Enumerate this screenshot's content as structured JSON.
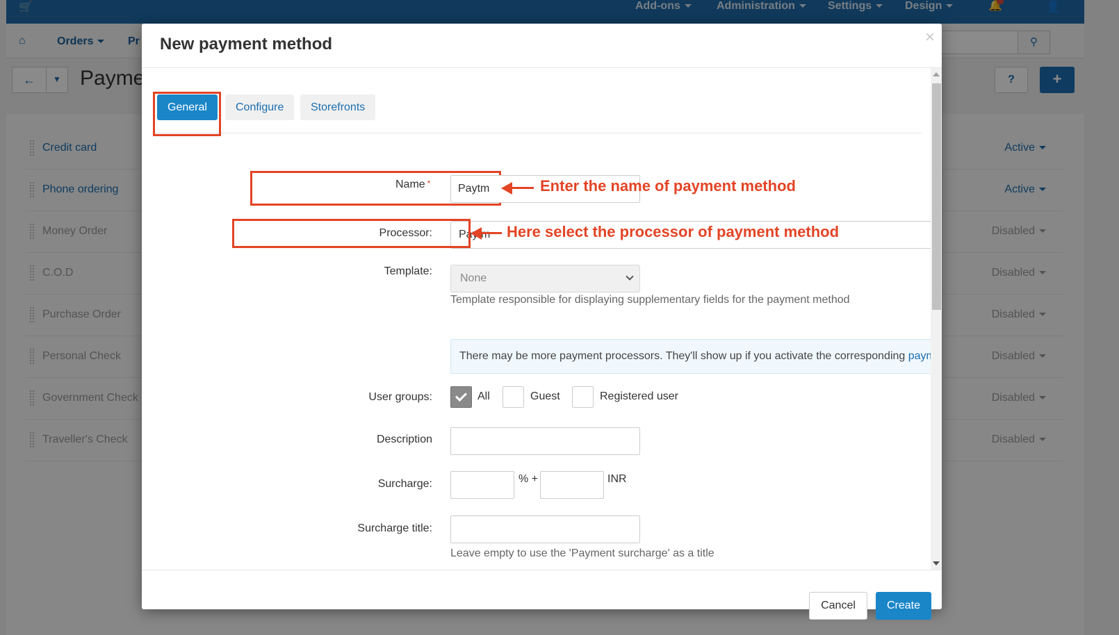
{
  "topbar": {
    "menus": [
      "Add-ons",
      "Administration",
      "Settings",
      "Design"
    ]
  },
  "nav": {
    "items": [
      "Orders",
      "Pr"
    ]
  },
  "toolbar": {
    "page_title": "Payme"
  },
  "payment_methods": [
    {
      "name": "Credit card",
      "status": "Active"
    },
    {
      "name": "Phone ordering",
      "status": "Active"
    },
    {
      "name": "Money Order",
      "status": "Disabled"
    },
    {
      "name": "C.O.D",
      "status": "Disabled"
    },
    {
      "name": "Purchase Order",
      "status": "Disabled"
    },
    {
      "name": "Personal Check",
      "status": "Disabled"
    },
    {
      "name": "Government Check",
      "status": "Disabled"
    },
    {
      "name": "Traveller's Check",
      "status": "Disabled"
    }
  ],
  "modal": {
    "title": "New payment method",
    "close": "×",
    "tabs": [
      "General",
      "Configure",
      "Storefronts"
    ],
    "name_label": "Name",
    "required_mark": "*",
    "name_value": "Paytm",
    "processor_label": "Processor:",
    "processor_value": "Paytm",
    "template_label": "Template:",
    "template_value": "None",
    "template_hint": "Template responsible for displaying supplementary fields for the payment method",
    "info_text": "There may be more payment processors. They'll show up if you activate the corresponding ",
    "info_link": "payment add-ons",
    "info_end": ".",
    "user_groups_label": "User groups:",
    "user_groups": [
      {
        "label": "All",
        "checked": true
      },
      {
        "label": "Guest",
        "checked": false
      },
      {
        "label": "Registered user",
        "checked": false
      }
    ],
    "description_label": "Description",
    "surcharge_label": "Surcharge:",
    "surcharge_percent": "% +",
    "currency": "INR",
    "surcharge_title_label": "Surcharge title:",
    "surcharge_title_hint": "Leave empty to use the 'Payment surcharge' as a title",
    "cancel_label": "Cancel",
    "create_label": "Create"
  },
  "annotations": {
    "name_note": "Enter the name of payment method",
    "processor_note": "Here select the processor of payment method"
  },
  "colors": {
    "accent": "#1a86c8",
    "annotation": "#e34425",
    "topbar": "#1f6aa8"
  }
}
